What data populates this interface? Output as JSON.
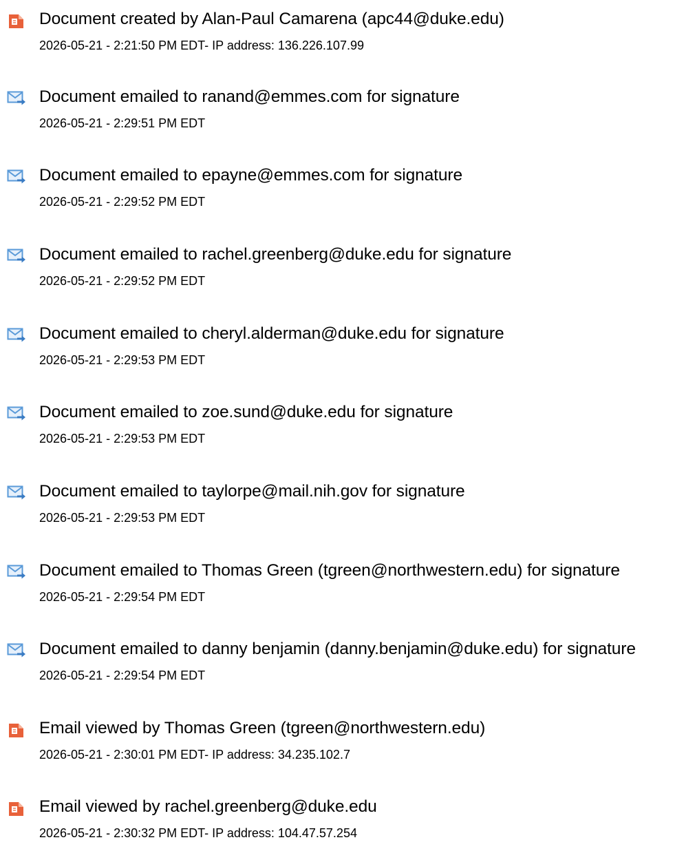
{
  "colors": {
    "doc_icon": "#e8613a",
    "email_icon": "#5a9ad8",
    "email_arrow": "#3a7cc4",
    "text": "#000000"
  },
  "events": [
    {
      "icon": "document-icon",
      "title": "Document created by Alan-Paul Camarena (apc44@duke.edu)",
      "meta": "2026-05-21 - 2:21:50 PM EDT- IP address: 136.226.107.99"
    },
    {
      "icon": "email-sent-icon",
      "title": "Document emailed to ranand@emmes.com for signature",
      "meta": "2026-05-21 - 2:29:51 PM EDT"
    },
    {
      "icon": "email-sent-icon",
      "title": "Document emailed to epayne@emmes.com for signature",
      "meta": "2026-05-21 - 2:29:52 PM EDT"
    },
    {
      "icon": "email-sent-icon",
      "title": "Document emailed to rachel.greenberg@duke.edu for signature",
      "meta": "2026-05-21 - 2:29:52 PM EDT"
    },
    {
      "icon": "email-sent-icon",
      "title": "Document emailed to cheryl.alderman@duke.edu for signature",
      "meta": "2026-05-21 - 2:29:53 PM EDT"
    },
    {
      "icon": "email-sent-icon",
      "title": "Document emailed to zoe.sund@duke.edu for signature",
      "meta": "2026-05-21 - 2:29:53 PM EDT"
    },
    {
      "icon": "email-sent-icon",
      "title": "Document emailed to taylorpe@mail.nih.gov for signature",
      "meta": "2026-05-21 - 2:29:53 PM EDT"
    },
    {
      "icon": "email-sent-icon",
      "title": "Document emailed to Thomas Green (tgreen@northwestern.edu) for signature",
      "meta": "2026-05-21 - 2:29:54 PM EDT"
    },
    {
      "icon": "email-sent-icon",
      "title": "Document emailed to danny benjamin (danny.benjamin@duke.edu) for signature",
      "meta": "2026-05-21 - 2:29:54 PM EDT"
    },
    {
      "icon": "document-icon",
      "title": "Email viewed by Thomas Green (tgreen@northwestern.edu)",
      "meta": "2026-05-21 - 2:30:01 PM EDT- IP address: 34.235.102.7"
    },
    {
      "icon": "document-icon",
      "title": "Email viewed by rachel.greenberg@duke.edu",
      "meta": "2026-05-21 - 2:30:32 PM EDT- IP address: 104.47.57.254"
    }
  ]
}
